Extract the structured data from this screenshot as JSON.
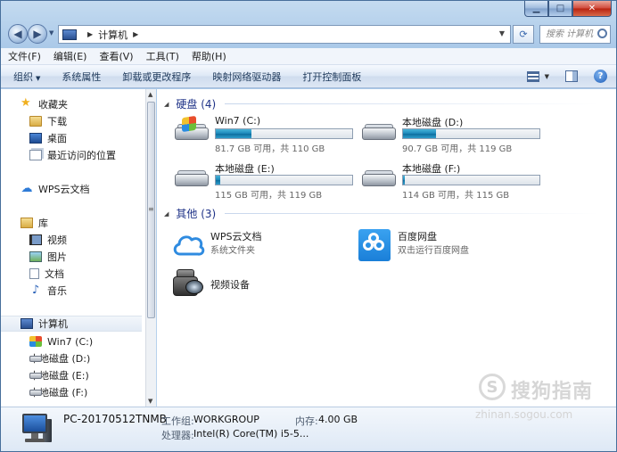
{
  "window": {
    "caption_min": "▁",
    "caption_max": "□",
    "caption_close": "✕"
  },
  "address": {
    "crumb": "计算机",
    "search_placeholder": "搜索 计算机"
  },
  "menubar": [
    {
      "label": "文件(F)"
    },
    {
      "label": "编辑(E)"
    },
    {
      "label": "查看(V)"
    },
    {
      "label": "工具(T)"
    },
    {
      "label": "帮助(H)"
    }
  ],
  "toolbar": {
    "organize": "组织",
    "system_properties": "系统属性",
    "uninstall": "卸载或更改程序",
    "map_drive": "映射网络驱动器",
    "control_panel": "打开控制面板",
    "help_icon": "?"
  },
  "nav": {
    "favorites": "收藏夹",
    "downloads": "下载",
    "desktop": "桌面",
    "recent": "最近访问的位置",
    "wps_cloud": "WPS云文档",
    "libraries": "库",
    "videos": "视频",
    "pictures": "图片",
    "documents": "文档",
    "music": "音乐",
    "computer": "计算机",
    "drive_c": "Win7 (C:)",
    "drive_d": "本地磁盘 (D:)",
    "drive_e": "本地磁盘 (E:)",
    "drive_f": "本地磁盘 (F:)"
  },
  "content": {
    "hdd_group": "硬盘 (4)",
    "other_group": "其他 (3)",
    "drives": [
      {
        "name": "Win7 (C:)",
        "free": "81.7 GB 可用，共 110 GB",
        "used_fraction": 0.26
      },
      {
        "name": "本地磁盘 (D:)",
        "free": "90.7 GB 可用，共 119 GB",
        "used_fraction": 0.24
      },
      {
        "name": "本地磁盘 (E:)",
        "free": "115 GB 可用，共 119 GB",
        "used_fraction": 0.03
      },
      {
        "name": "本地磁盘 (F:)",
        "free": "114 GB 可用，共 115 GB",
        "used_fraction": 0.01
      }
    ],
    "others": [
      {
        "name": "WPS云文档",
        "desc": "系统文件夹"
      },
      {
        "name": "百度网盘",
        "desc": "双击运行百度网盘"
      },
      {
        "name": "视频设备",
        "desc": ""
      }
    ]
  },
  "details": {
    "pc_name": "PC-20170512TNMB",
    "workgroup_label": "工作组:",
    "workgroup_value": "WORKGROUP",
    "memory_label": "内存:",
    "memory_value": "4.00 GB",
    "cpu_label": "处理器:",
    "cpu_value": "Intel(R) Core(TM) i5-5..."
  },
  "watermark": {
    "logo_char": "S",
    "text": "搜狗指南",
    "url": "zhinan.sogou.com"
  },
  "colors": {
    "accent": "#1e3287",
    "drive_bar": "#1a86b8"
  }
}
